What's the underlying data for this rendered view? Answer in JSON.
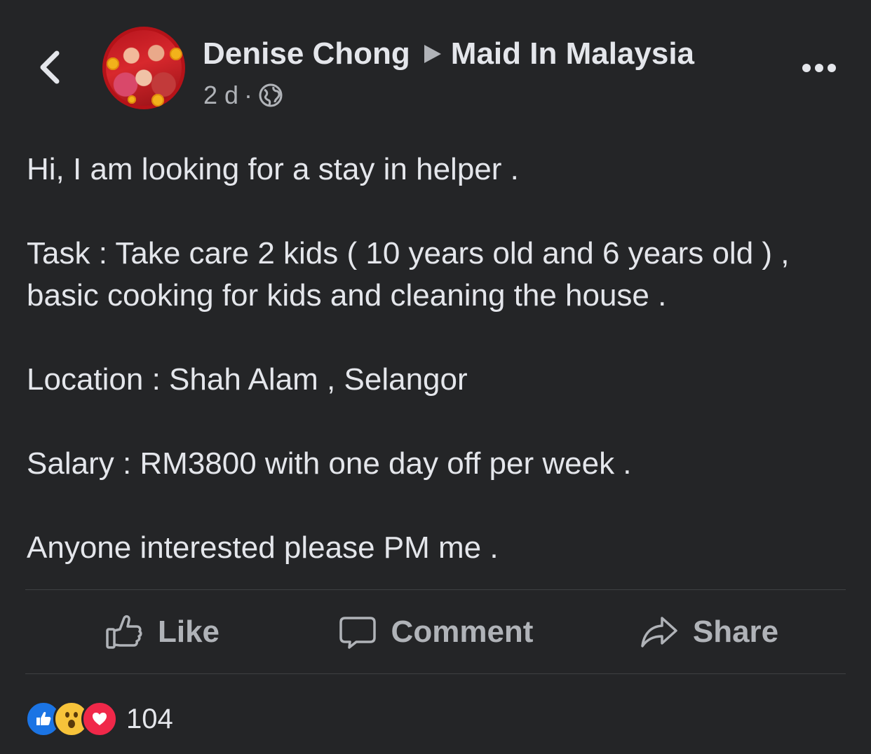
{
  "header": {
    "author": "Denise Chong",
    "group": "Maid In Malaysia",
    "time": "2 d",
    "separator": "·"
  },
  "icons": {
    "back": "chevron-left-icon",
    "privacy": "globe-icon",
    "more": "more-horizontal-icon",
    "like": "thumbs-up-icon",
    "comment": "speech-bubble-icon",
    "share": "share-arrow-icon"
  },
  "post": {
    "paragraphs": [
      "Hi, I am looking for a stay in helper .",
      "Task : Take care 2 kids ( 10 years old and 6 years old ) , basic cooking for kids and cleaning the house .",
      "Location : Shah Alam , Selangor",
      "Salary : RM3800 with one day off per week .",
      "Anyone interested please PM me ."
    ]
  },
  "actions": {
    "like": "Like",
    "comment": "Comment",
    "share": "Share"
  },
  "reactions": {
    "types": [
      "like",
      "wow",
      "love"
    ],
    "count": "104"
  },
  "colors": {
    "background": "#242527",
    "text": "#e4e6eb",
    "secondary": "#b0b3b8",
    "like_blue": "#1b74e4",
    "love_red": "#f02849",
    "wow_yellow": "#f7c33a"
  }
}
